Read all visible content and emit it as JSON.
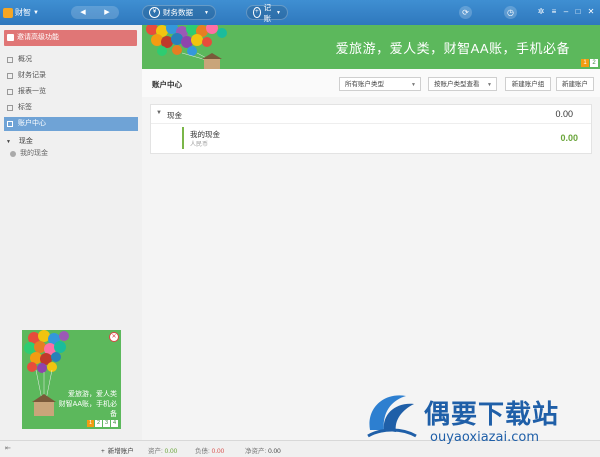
{
  "titlebar": {
    "app_name": "财智",
    "nav_back": "◀",
    "nav_forward": "▶",
    "data_menu": "财务数据",
    "record_menu": "记账",
    "sync_icon": "sync-icon",
    "clock_icon": "clock-icon",
    "window_controls": [
      "skin-icon",
      "menu-icon",
      "minimize-icon",
      "maximize-icon",
      "close-icon"
    ]
  },
  "sidebar": {
    "invite": "邀请高级功能",
    "menu": [
      {
        "label": "概况",
        "active": false
      },
      {
        "label": "财务记录",
        "active": false
      },
      {
        "label": "报表一览",
        "active": false
      },
      {
        "label": "标签",
        "active": false
      },
      {
        "label": "账户中心",
        "active": true
      }
    ],
    "tree": {
      "group": "现金",
      "items": [
        "我的现金"
      ]
    },
    "ad": {
      "text_line1": "爱旅游，爱人类",
      "text_line2": "财智AA账，手机必备",
      "pages": [
        "1",
        "2",
        "3",
        "4"
      ]
    }
  },
  "banner": {
    "slogan": "爱旅游，爱人类，财智AA账，手机必备",
    "pages": [
      "1",
      "2"
    ]
  },
  "toolbar": {
    "title": "账户中心",
    "filter_type": "所有账户类型",
    "view_by": "按账户类型查看",
    "new_group": "新建账户组",
    "new_account": "新建账户"
  },
  "accounts": {
    "group_name": "现金",
    "group_amount": "0.00",
    "rows": [
      {
        "name": "我的现金",
        "currency": "人民币",
        "amount": "0.00"
      }
    ]
  },
  "statusbar": {
    "add_account": "新增账户",
    "assets_label": "资产:",
    "assets_value": "0.00",
    "liabilities_label": "负债:",
    "liabilities_value": "0.00",
    "net_label": "净资产:",
    "net_value": "0.00"
  },
  "watermark": {
    "cn": "偶要下载站",
    "en": "ouyaoxiazai.com"
  },
  "colors": {
    "titlebar": "#2f78bd",
    "banner_green": "#5cb85c",
    "active_menu": "#6fa3d6",
    "invite_red": "#e07676",
    "amount_green": "#6aa53a"
  }
}
